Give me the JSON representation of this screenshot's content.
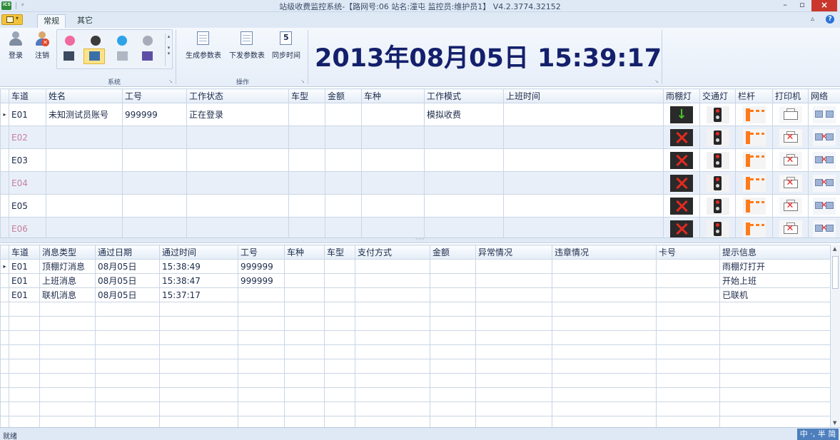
{
  "window": {
    "title": "站级收费监控系统-【路网号:06 站名:潼屯 监控员:维护员1】 V4.2.3774.32152",
    "app_icon_text": "iCS",
    "min_label": "–",
    "max_label": "▫",
    "close_label": "×"
  },
  "ribbon": {
    "tabs": [
      "常规",
      "其它"
    ],
    "collapse_label": "▵",
    "help_label": "?",
    "login_label": "登录",
    "logout_label": "注销",
    "group_system": "系统",
    "group_ops": "操作",
    "gen_params_label": "生成参数表",
    "send_params_label": "下发参数表",
    "sync_time_label": "同步时间",
    "sync_icon_text": "5"
  },
  "clock": "2013年08月05日 15:39:17",
  "lanes": {
    "columns": [
      "车道",
      "姓名",
      "工号",
      "工作状态",
      "车型",
      "金额",
      "车种",
      "工作模式",
      "上班时间",
      "雨棚灯",
      "交通灯",
      "栏杆",
      "打印机",
      "网络"
    ],
    "rows": [
      {
        "lane": "E01",
        "name": "未知测试员账号",
        "id": "999999",
        "state": "正在登录",
        "vtype": "",
        "amount": "",
        "vclass": "",
        "mode": "模拟收费",
        "on_time": "",
        "canopy": "green",
        "selected": true
      },
      {
        "lane": "E02",
        "name": "",
        "id": "",
        "state": "",
        "vtype": "",
        "amount": "",
        "vclass": "",
        "mode": "",
        "on_time": "",
        "canopy": "red",
        "selected": false
      },
      {
        "lane": "E03",
        "name": "",
        "id": "",
        "state": "",
        "vtype": "",
        "amount": "",
        "vclass": "",
        "mode": "",
        "on_time": "",
        "canopy": "red",
        "selected": false
      },
      {
        "lane": "E04",
        "name": "",
        "id": "",
        "state": "",
        "vtype": "",
        "amount": "",
        "vclass": "",
        "mode": "",
        "on_time": "",
        "canopy": "red",
        "selected": false
      },
      {
        "lane": "E05",
        "name": "",
        "id": "",
        "state": "",
        "vtype": "",
        "amount": "",
        "vclass": "",
        "mode": "",
        "on_time": "",
        "canopy": "red",
        "selected": false
      },
      {
        "lane": "E06",
        "name": "",
        "id": "",
        "state": "",
        "vtype": "",
        "amount": "",
        "vclass": "",
        "mode": "",
        "on_time": "",
        "canopy": "red",
        "selected": false
      }
    ]
  },
  "log": {
    "columns": [
      "车道",
      "消息类型",
      "通过日期",
      "通过时间",
      "工号",
      "车种",
      "车型",
      "支付方式",
      "金额",
      "异常情况",
      "违章情况",
      "卡号",
      "提示信息"
    ],
    "rows": [
      [
        "E01",
        "顶棚灯消息",
        "08月05日",
        "15:38:49",
        "999999",
        "",
        "",
        "",
        "",
        "",
        "",
        "",
        "雨棚灯打开"
      ],
      [
        "E01",
        "上班消息",
        "08月05日",
        "15:38:47",
        "999999",
        "",
        "",
        "",
        "",
        "",
        "",
        "",
        "开始上班"
      ],
      [
        "E01",
        "联机消息",
        "08月05日",
        "15:37:17",
        "",
        "",
        "",
        "",
        "",
        "",
        "",
        "",
        "已联机"
      ]
    ],
    "empty_rows": 9
  },
  "status": {
    "text": "就绪",
    "ime": "中 ·, 半 简"
  },
  "colors": {
    "clock": "#14206b",
    "alt_row": "#e9eff8",
    "alt_lane_text": "#c57fa0",
    "close_button": "#c9372c"
  }
}
